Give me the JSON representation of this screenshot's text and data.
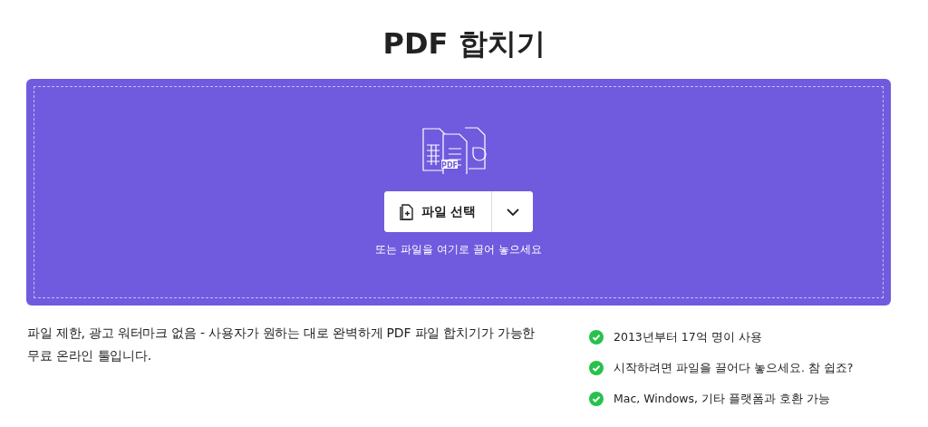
{
  "title": "PDF 합치기",
  "drop": {
    "icon_label": "PDF",
    "button": "파일 선택",
    "hint": "또는 파일을 여기로 끌어 놓으세요"
  },
  "description": "파일 제한, 광고 워터마크 없음 - 사용자가 원하는 대로 완벽하게 PDF 파일 합치기가 가능한 무료 온라인 툴입니다.",
  "features": [
    {
      "text": "2013년부터 17억 명이 사용"
    },
    {
      "text": "시작하려면 파일을 끌어다 놓으세요. 참 쉽죠?"
    },
    {
      "text": "Mac, Windows, 기타 플랫폼과 호환 가능"
    }
  ]
}
